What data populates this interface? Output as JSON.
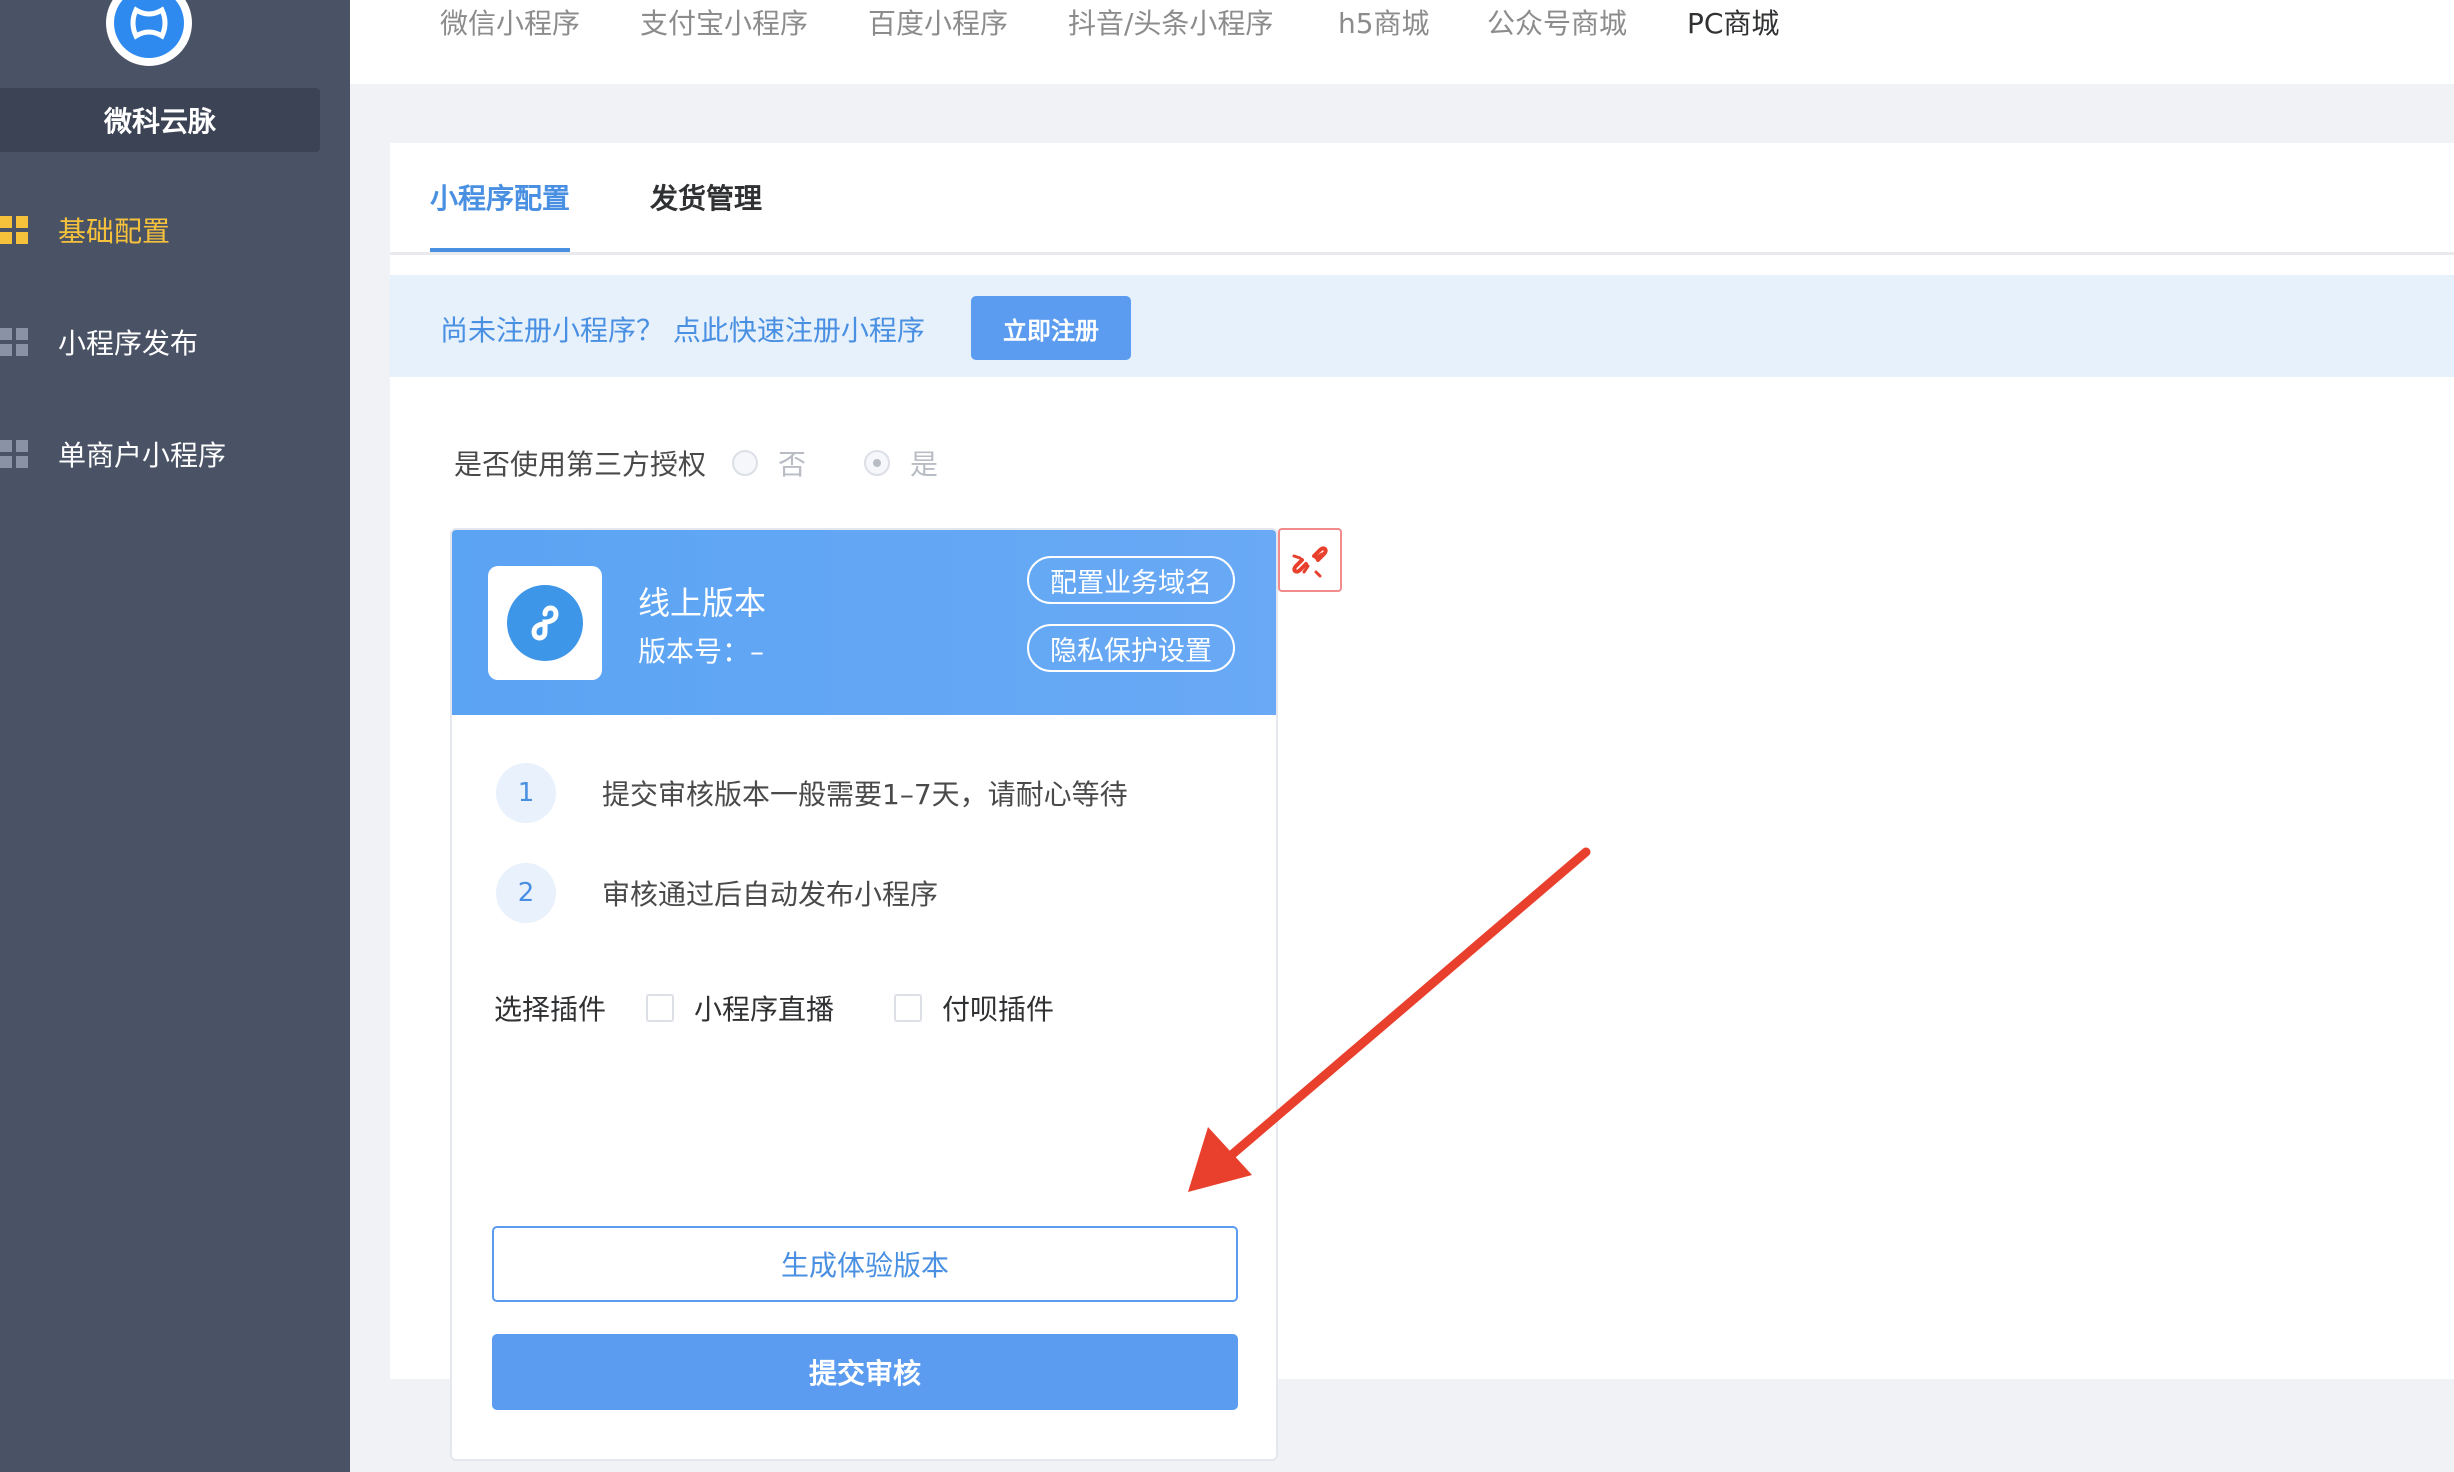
{
  "sidebar": {
    "brand": "微科云脉",
    "items": [
      {
        "label": "基础配置",
        "active": true
      },
      {
        "label": "小程序发布",
        "active": false
      },
      {
        "label": "单商户小程序",
        "active": false
      }
    ]
  },
  "topnav": {
    "links": [
      "微信小程序",
      "支付宝小程序",
      "百度小程序",
      "抖音/头条小程序",
      "h5商城",
      "公众号商城",
      "PC商城"
    ]
  },
  "tabs": {
    "items": [
      "小程序配置",
      "发货管理"
    ],
    "active": "小程序配置"
  },
  "notice": {
    "text": "尚未注册小程序？ 点此快速注册小程序",
    "button": "立即注册"
  },
  "auth": {
    "label": "是否使用第三方授权",
    "options": [
      "否",
      "是"
    ],
    "selected": "是"
  },
  "version_card": {
    "title": "线上版本",
    "version": "版本号：–",
    "domain_button": "配置业务域名",
    "privacy_button": "隐私保护设置",
    "steps": [
      {
        "num": "1",
        "text": "提交审核版本一般需要1–7天，请耐心等待"
      },
      {
        "num": "2",
        "text": "审核通过后自动发布小程序"
      }
    ],
    "plugin_label": "选择插件",
    "plugins": [
      "小程序直播",
      "付呗插件"
    ],
    "experience_button": "生成体验版本",
    "submit_button": "提交审核"
  },
  "colors": {
    "sidebar": "#4a5366",
    "accent": "#4a90e2",
    "primary_button": "#5b9cf0",
    "active_menu": "#f7c23b",
    "annotation_arrow": "#e8402c"
  }
}
